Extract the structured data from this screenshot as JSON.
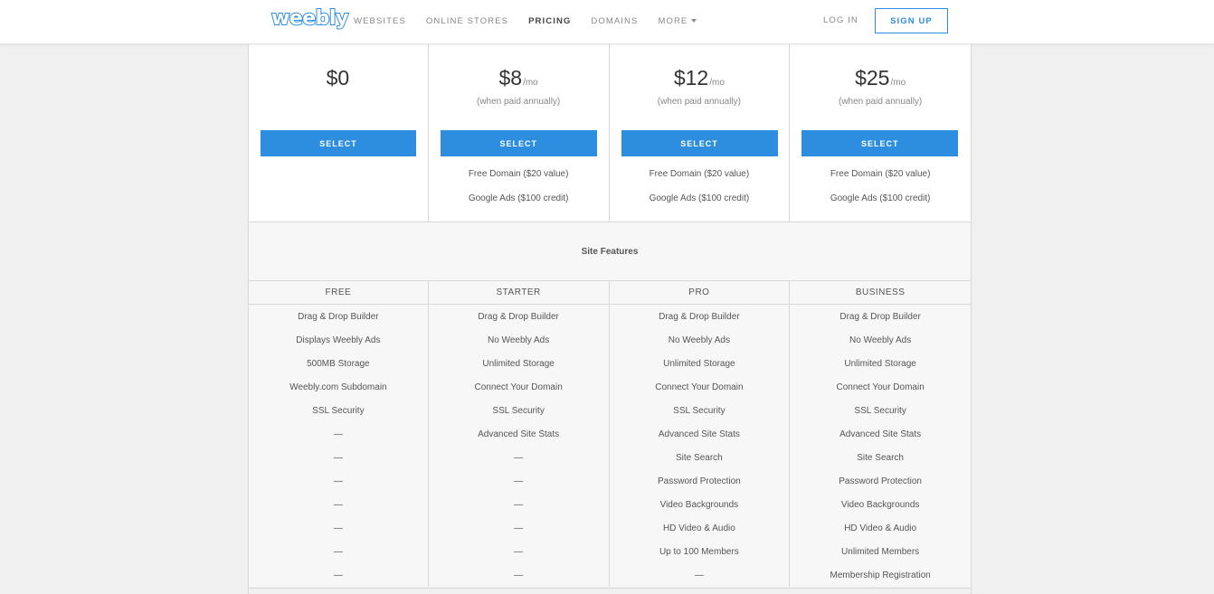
{
  "header": {
    "logo": "weebly",
    "nav": [
      {
        "label": "WEBSITES",
        "active": false
      },
      {
        "label": "ONLINE STORES",
        "active": false
      },
      {
        "label": "PRICING",
        "active": true
      },
      {
        "label": "DOMAINS",
        "active": false
      },
      {
        "label": "MORE",
        "active": false
      }
    ],
    "login_label": "LOG IN",
    "signup_label": "SIGN UP"
  },
  "plans": [
    {
      "price": "$0",
      "per": "",
      "note": "",
      "select_label": "SELECT",
      "perk1": "",
      "perk2": ""
    },
    {
      "price": "$8",
      "per": "/mo",
      "note": "(when paid annually)",
      "select_label": "SELECT",
      "perk1": "Free Domain ($20 value)",
      "perk2": "Google Ads ($100 credit)"
    },
    {
      "price": "$12",
      "per": "/mo",
      "note": "(when paid annually)",
      "select_label": "SELECT",
      "perk1": "Free Domain ($20 value)",
      "perk2": "Google Ads ($100 credit)"
    },
    {
      "price": "$25",
      "per": "/mo",
      "note": "(when paid annually)",
      "select_label": "SELECT",
      "perk1": "Free Domain ($20 value)",
      "perk2": "Google Ads ($100 credit)"
    }
  ],
  "features": {
    "section_title": "Site Features",
    "columns": [
      {
        "name": "FREE",
        "items": [
          "Drag & Drop Builder",
          "Displays Weebly Ads",
          "500MB Storage",
          "Weebly.com Subdomain",
          "SSL Security",
          "—",
          "—",
          "—",
          "—",
          "—",
          "—",
          "—"
        ]
      },
      {
        "name": "STARTER",
        "items": [
          "Drag & Drop Builder",
          "No Weebly Ads",
          "Unlimited Storage",
          "Connect Your Domain",
          "SSL Security",
          "Advanced Site Stats",
          "—",
          "—",
          "—",
          "—",
          "—",
          "—"
        ]
      },
      {
        "name": "PRO",
        "items": [
          "Drag & Drop Builder",
          "No Weebly Ads",
          "Unlimited Storage",
          "Connect Your Domain",
          "SSL Security",
          "Advanced Site Stats",
          "Site Search",
          "Password Protection",
          "Video Backgrounds",
          "HD Video & Audio",
          "Up to 100 Members",
          "—"
        ]
      },
      {
        "name": "BUSINESS",
        "items": [
          "Drag & Drop Builder",
          "No Weebly Ads",
          "Unlimited Storage",
          "Connect Your Domain",
          "SSL Security",
          "Advanced Site Stats",
          "Site Search",
          "Password Protection",
          "Video Backgrounds",
          "HD Video & Audio",
          "Unlimited Members",
          "Membership Registration"
        ]
      }
    ]
  },
  "colors": {
    "accent": "#2d8ee0",
    "page_bg": "#f0f0f0",
    "panel_bg": "#f7f7f7"
  }
}
